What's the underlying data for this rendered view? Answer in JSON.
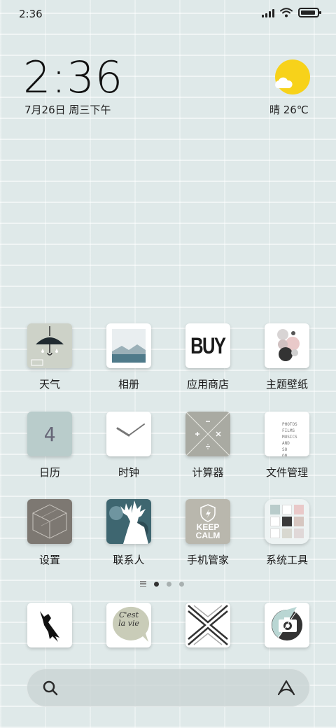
{
  "status_bar": {
    "time": "2:36"
  },
  "widget": {
    "clock": "2:36",
    "date": "7月26日 周三下午",
    "weather": "晴 26℃",
    "weather_icon": "sun-cloud-icon"
  },
  "apps": [
    {
      "label": "天气",
      "icon": "weather-umbrella-icon"
    },
    {
      "label": "相册",
      "icon": "gallery-landscape-icon"
    },
    {
      "label": "应用商店",
      "icon": "app-store-buy-icon",
      "icon_text": "BUY"
    },
    {
      "label": "主题壁纸",
      "icon": "themes-bubbles-icon"
    },
    {
      "label": "日历",
      "icon": "calendar-icon",
      "icon_text": "4"
    },
    {
      "label": "时钟",
      "icon": "clock-hands-icon"
    },
    {
      "label": "计算器",
      "icon": "calculator-cross-icon"
    },
    {
      "label": "文件管理",
      "icon": "file-manager-text-icon",
      "icon_text": "PHOTOS FILMS MUSICS AND SO ON"
    },
    {
      "label": "设置",
      "icon": "settings-cube-icon"
    },
    {
      "label": "联系人",
      "icon": "contacts-deer-icon"
    },
    {
      "label": "手机管家",
      "icon": "security-keep-calm-icon",
      "icon_text": "KEEP CALM"
    },
    {
      "label": "系统工具",
      "icon": "system-tools-folder-icon"
    }
  ],
  "pager": {
    "page_count": 3,
    "active_index": 0
  },
  "dock": [
    {
      "icon": "bird-icon"
    },
    {
      "icon": "cest-la-vie-message-icon",
      "icon_text": "C'est la vie"
    },
    {
      "icon": "stripes-x-icon"
    },
    {
      "icon": "camera-icon"
    }
  ],
  "search": {
    "icon": "search-icon",
    "assistant_icon": "assistant-icon"
  }
}
